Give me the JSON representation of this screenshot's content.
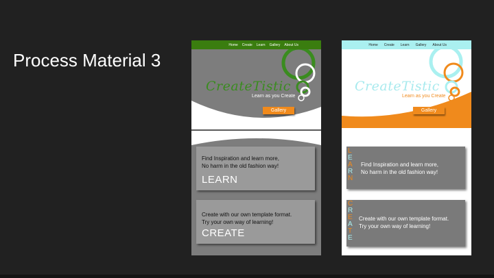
{
  "slide": {
    "title": "Process Material 3"
  },
  "nav": [
    "Home",
    "Create",
    "Learn",
    "Gallery",
    "About Us"
  ],
  "brand": {
    "name": "CreateTistic",
    "tagline": "Learn as you Create",
    "gallery_button": "Gallery"
  },
  "cards": {
    "learn": {
      "line1": "Find Inspiration and learn more,",
      "line2": "No harm in the old fashion way!",
      "heading": "LEARN"
    },
    "create": {
      "line1": "Create with our own template format.",
      "line2": "Try your own way of learning!",
      "heading": "CREATE"
    }
  },
  "vertical": {
    "learn": [
      "L",
      "E",
      "A",
      "R",
      "N"
    ],
    "create": [
      "C",
      "R",
      "E",
      "A",
      "T",
      "E"
    ]
  },
  "colors": {
    "green": "#3a7d0f",
    "gray": "#7d7d7d",
    "cyan": "#aaf0f0",
    "orange": "#f08a1c"
  }
}
